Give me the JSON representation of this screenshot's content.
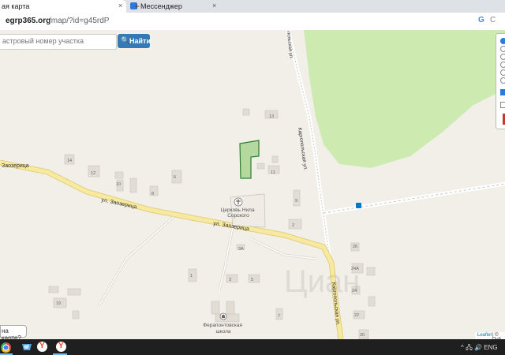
{
  "browser": {
    "tabs": [
      {
        "label": "ая карта",
        "close": "×"
      },
      {
        "label": "Мессенджер",
        "close": "×"
      }
    ],
    "new_tab": "+",
    "address": {
      "domain": "egrp365.org",
      "path": "/map/?id=g45rdP"
    },
    "extensions": [
      "G",
      "C"
    ]
  },
  "map": {
    "search": {
      "placeholder": "астровый номер участка",
      "button_label": "Найти",
      "button_icon": "search-icon"
    },
    "streets": {
      "zaozeritsa_1": "Заозерица",
      "zaozeritsa_2": "ул. Заозерица",
      "zaozeritsa_3": "ул. Заозерица",
      "kargopolskaya_1": "Каргопольская ул.",
      "kargopolskaya_2": "Каргопольская ул.",
      "kargopolskaya_top": "польская ул."
    },
    "pois": {
      "church": "Церковь Нила Сорского",
      "school": "Ферапонтовская школа"
    },
    "house_numbers": [
      "13",
      "11",
      "14",
      "12",
      "10",
      "8",
      "6",
      "9",
      "2",
      "3А",
      "1",
      "3",
      "5",
      "7",
      "19",
      "26",
      "24А",
      "24",
      "22",
      "20"
    ],
    "popup_text": "на карте?",
    "attribution": {
      "leaflet": "Leaflet",
      "rest": "| © Пуб"
    },
    "watermark": "Циан",
    "layers": {
      "radios": 6,
      "selected_radio": 0,
      "checkboxes_checked": [
        true,
        false
      ]
    }
  },
  "colors": {
    "accent_button": "#337ab7",
    "parcel_green": "#b5d89f",
    "forest_green": "#cdebb0",
    "road_yellow": "#f8e9a1"
  },
  "taskbar": {
    "apps": [
      "chrome",
      "files",
      "yandex",
      "yandex"
    ],
    "tray": "^ 🖧 🔊 ENG"
  }
}
